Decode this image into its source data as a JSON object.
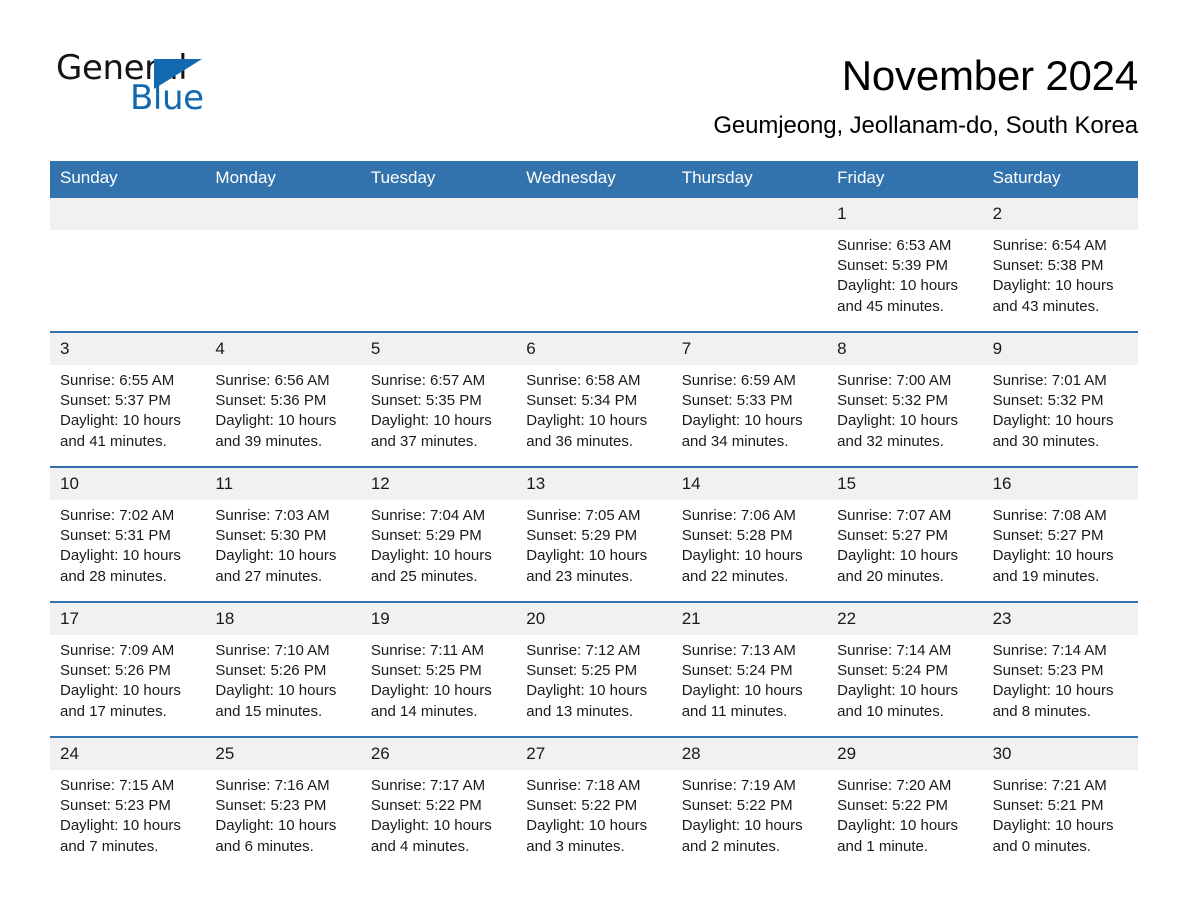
{
  "brand": {
    "name_part1": "General",
    "name_part2": "Blue",
    "triangle_icon": "brand-triangle-icon",
    "accent_color": "#1269b0"
  },
  "header": {
    "month_title": "November 2024",
    "location": "Geumjeong, Jeollanam-do, South Korea"
  },
  "theme": {
    "header_blue": "#3273ad",
    "date_band_gray": "#f1f1f1",
    "text_black": "#1a1a1a"
  },
  "weekdays": [
    "Sunday",
    "Monday",
    "Tuesday",
    "Wednesday",
    "Thursday",
    "Friday",
    "Saturday"
  ],
  "weeks": [
    [
      {
        "day": "",
        "sunrise": "",
        "sunset": "",
        "daylight": ""
      },
      {
        "day": "",
        "sunrise": "",
        "sunset": "",
        "daylight": ""
      },
      {
        "day": "",
        "sunrise": "",
        "sunset": "",
        "daylight": ""
      },
      {
        "day": "",
        "sunrise": "",
        "sunset": "",
        "daylight": ""
      },
      {
        "day": "",
        "sunrise": "",
        "sunset": "",
        "daylight": ""
      },
      {
        "day": "1",
        "sunrise": "Sunrise: 6:53 AM",
        "sunset": "Sunset: 5:39 PM",
        "daylight": "Daylight: 10 hours and 45 minutes."
      },
      {
        "day": "2",
        "sunrise": "Sunrise: 6:54 AM",
        "sunset": "Sunset: 5:38 PM",
        "daylight": "Daylight: 10 hours and 43 minutes."
      }
    ],
    [
      {
        "day": "3",
        "sunrise": "Sunrise: 6:55 AM",
        "sunset": "Sunset: 5:37 PM",
        "daylight": "Daylight: 10 hours and 41 minutes."
      },
      {
        "day": "4",
        "sunrise": "Sunrise: 6:56 AM",
        "sunset": "Sunset: 5:36 PM",
        "daylight": "Daylight: 10 hours and 39 minutes."
      },
      {
        "day": "5",
        "sunrise": "Sunrise: 6:57 AM",
        "sunset": "Sunset: 5:35 PM",
        "daylight": "Daylight: 10 hours and 37 minutes."
      },
      {
        "day": "6",
        "sunrise": "Sunrise: 6:58 AM",
        "sunset": "Sunset: 5:34 PM",
        "daylight": "Daylight: 10 hours and 36 minutes."
      },
      {
        "day": "7",
        "sunrise": "Sunrise: 6:59 AM",
        "sunset": "Sunset: 5:33 PM",
        "daylight": "Daylight: 10 hours and 34 minutes."
      },
      {
        "day": "8",
        "sunrise": "Sunrise: 7:00 AM",
        "sunset": "Sunset: 5:32 PM",
        "daylight": "Daylight: 10 hours and 32 minutes."
      },
      {
        "day": "9",
        "sunrise": "Sunrise: 7:01 AM",
        "sunset": "Sunset: 5:32 PM",
        "daylight": "Daylight: 10 hours and 30 minutes."
      }
    ],
    [
      {
        "day": "10",
        "sunrise": "Sunrise: 7:02 AM",
        "sunset": "Sunset: 5:31 PM",
        "daylight": "Daylight: 10 hours and 28 minutes."
      },
      {
        "day": "11",
        "sunrise": "Sunrise: 7:03 AM",
        "sunset": "Sunset: 5:30 PM",
        "daylight": "Daylight: 10 hours and 27 minutes."
      },
      {
        "day": "12",
        "sunrise": "Sunrise: 7:04 AM",
        "sunset": "Sunset: 5:29 PM",
        "daylight": "Daylight: 10 hours and 25 minutes."
      },
      {
        "day": "13",
        "sunrise": "Sunrise: 7:05 AM",
        "sunset": "Sunset: 5:29 PM",
        "daylight": "Daylight: 10 hours and 23 minutes."
      },
      {
        "day": "14",
        "sunrise": "Sunrise: 7:06 AM",
        "sunset": "Sunset: 5:28 PM",
        "daylight": "Daylight: 10 hours and 22 minutes."
      },
      {
        "day": "15",
        "sunrise": "Sunrise: 7:07 AM",
        "sunset": "Sunset: 5:27 PM",
        "daylight": "Daylight: 10 hours and 20 minutes."
      },
      {
        "day": "16",
        "sunrise": "Sunrise: 7:08 AM",
        "sunset": "Sunset: 5:27 PM",
        "daylight": "Daylight: 10 hours and 19 minutes."
      }
    ],
    [
      {
        "day": "17",
        "sunrise": "Sunrise: 7:09 AM",
        "sunset": "Sunset: 5:26 PM",
        "daylight": "Daylight: 10 hours and 17 minutes."
      },
      {
        "day": "18",
        "sunrise": "Sunrise: 7:10 AM",
        "sunset": "Sunset: 5:26 PM",
        "daylight": "Daylight: 10 hours and 15 minutes."
      },
      {
        "day": "19",
        "sunrise": "Sunrise: 7:11 AM",
        "sunset": "Sunset: 5:25 PM",
        "daylight": "Daylight: 10 hours and 14 minutes."
      },
      {
        "day": "20",
        "sunrise": "Sunrise: 7:12 AM",
        "sunset": "Sunset: 5:25 PM",
        "daylight": "Daylight: 10 hours and 13 minutes."
      },
      {
        "day": "21",
        "sunrise": "Sunrise: 7:13 AM",
        "sunset": "Sunset: 5:24 PM",
        "daylight": "Daylight: 10 hours and 11 minutes."
      },
      {
        "day": "22",
        "sunrise": "Sunrise: 7:14 AM",
        "sunset": "Sunset: 5:24 PM",
        "daylight": "Daylight: 10 hours and 10 minutes."
      },
      {
        "day": "23",
        "sunrise": "Sunrise: 7:14 AM",
        "sunset": "Sunset: 5:23 PM",
        "daylight": "Daylight: 10 hours and 8 minutes."
      }
    ],
    [
      {
        "day": "24",
        "sunrise": "Sunrise: 7:15 AM",
        "sunset": "Sunset: 5:23 PM",
        "daylight": "Daylight: 10 hours and 7 minutes."
      },
      {
        "day": "25",
        "sunrise": "Sunrise: 7:16 AM",
        "sunset": "Sunset: 5:23 PM",
        "daylight": "Daylight: 10 hours and 6 minutes."
      },
      {
        "day": "26",
        "sunrise": "Sunrise: 7:17 AM",
        "sunset": "Sunset: 5:22 PM",
        "daylight": "Daylight: 10 hours and 4 minutes."
      },
      {
        "day": "27",
        "sunrise": "Sunrise: 7:18 AM",
        "sunset": "Sunset: 5:22 PM",
        "daylight": "Daylight: 10 hours and 3 minutes."
      },
      {
        "day": "28",
        "sunrise": "Sunrise: 7:19 AM",
        "sunset": "Sunset: 5:22 PM",
        "daylight": "Daylight: 10 hours and 2 minutes."
      },
      {
        "day": "29",
        "sunrise": "Sunrise: 7:20 AM",
        "sunset": "Sunset: 5:22 PM",
        "daylight": "Daylight: 10 hours and 1 minute."
      },
      {
        "day": "30",
        "sunrise": "Sunrise: 7:21 AM",
        "sunset": "Sunset: 5:21 PM",
        "daylight": "Daylight: 10 hours and 0 minutes."
      }
    ]
  ]
}
